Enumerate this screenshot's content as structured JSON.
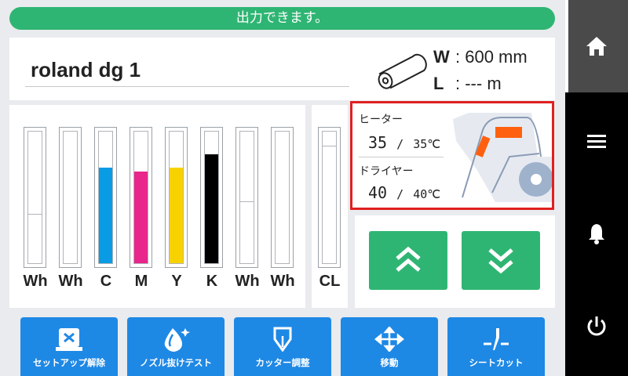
{
  "status": {
    "message": "出力できます。",
    "color": "#2fb573"
  },
  "device": {
    "name": "roland dg 1"
  },
  "media": {
    "width_key": "W",
    "width_value": ": 600 mm",
    "length_key": "L",
    "length_value": ": --- m"
  },
  "inks": [
    {
      "label": "Wh",
      "level": 0.37,
      "color": "#ffffff"
    },
    {
      "label": "Wh",
      "level": 1.0,
      "color": "#ffffff"
    },
    {
      "label": "C",
      "level": 0.72,
      "color": "#0a9be5"
    },
    {
      "label": "M",
      "level": 0.69,
      "color": "#e8268c"
    },
    {
      "label": "Y",
      "level": 0.72,
      "color": "#f8d200"
    },
    {
      "label": "K",
      "level": 0.82,
      "color": "#000000"
    },
    {
      "label": "Wh",
      "level": 0.47,
      "color": "#ffffff"
    },
    {
      "label": "Wh",
      "level": 1.0,
      "color": "#ffffff"
    }
  ],
  "cl": {
    "label": "CL",
    "level": 0.89
  },
  "heater": {
    "heater_label": "ヒーター",
    "heater_current": "35",
    "heater_sep": "/",
    "heater_target": "35℃",
    "dryer_label": "ドライヤー",
    "dryer_current": "40",
    "dryer_sep": "/",
    "dryer_target": "40℃",
    "highlight_color": "#e02020"
  },
  "feed": {
    "up_icon": "double-chevron-up-icon",
    "down_icon": "double-chevron-down-icon"
  },
  "actions": [
    {
      "label": "セットアップ解除",
      "icon": "setup-release-icon"
    },
    {
      "label": "ノズル抜けテスト",
      "icon": "nozzle-test-icon"
    },
    {
      "label": "カッター調整",
      "icon": "cutter-adjust-icon"
    },
    {
      "label": "移動",
      "icon": "move-icon"
    },
    {
      "label": "シートカット",
      "icon": "sheet-cut-icon"
    }
  ],
  "sidebar": {
    "items": [
      "home-icon",
      "menu-icon",
      "bell-icon",
      "power-icon"
    ]
  },
  "colors": {
    "accent_green": "#2fb573",
    "action_blue": "#1e88e5"
  }
}
